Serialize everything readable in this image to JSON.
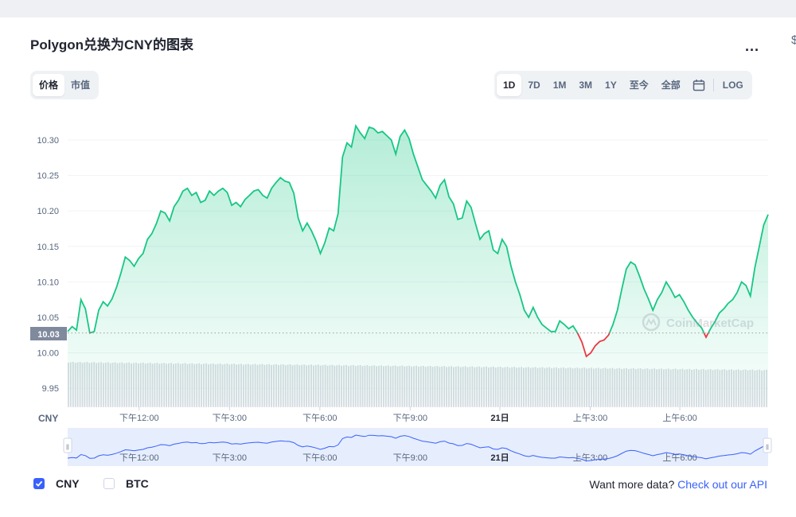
{
  "title": "Polygon兑换为CNY的图表",
  "menu_glyph": "...",
  "edge_glyph": "$",
  "view_tabs": [
    {
      "label": "价格",
      "active": true
    },
    {
      "label": "市值",
      "active": false
    }
  ],
  "range_tabs": [
    {
      "label": "1D",
      "active": true
    },
    {
      "label": "7D",
      "active": false
    },
    {
      "label": "1M",
      "active": false
    },
    {
      "label": "3M",
      "active": false
    },
    {
      "label": "1Y",
      "active": false
    },
    {
      "label": "至今",
      "active": false
    },
    {
      "label": "全部",
      "active": false
    }
  ],
  "calendar_icon": "calendar-icon",
  "log_label": "LOG",
  "chart_data": {
    "type": "line",
    "y_ticks": [
      "10.30",
      "10.25",
      "10.20",
      "10.15",
      "10.10",
      "10.05",
      "10.00",
      "9.95"
    ],
    "ylim": [
      9.925,
      10.335
    ],
    "x_ticks": [
      {
        "label": "下午12:00",
        "t": 0.102
      },
      {
        "label": "下午3:00",
        "t": 0.231
      },
      {
        "label": "下午6:00",
        "t": 0.36
      },
      {
        "label": "下午9:00",
        "t": 0.489
      },
      {
        "label": "21日",
        "t": 0.617,
        "bold": true
      },
      {
        "label": "上午3:00",
        "t": 0.746
      },
      {
        "label": "上午6:00",
        "t": 0.874
      }
    ],
    "currency_label": "CNY",
    "open_price_label": "10.03",
    "open_price": 10.028,
    "series": [
      {
        "values": [
          10.03,
          10.037,
          10.032,
          10.075,
          10.062,
          10.028,
          10.03,
          10.06,
          10.072,
          10.066,
          10.076,
          10.092,
          10.112,
          10.135,
          10.13,
          10.122,
          10.133,
          10.14,
          10.16,
          10.168,
          10.182,
          10.2,
          10.197,
          10.186,
          10.206,
          10.215,
          10.228,
          10.232,
          10.222,
          10.226,
          10.212,
          10.215,
          10.228,
          10.222,
          10.228,
          10.232,
          10.226,
          10.208,
          10.212,
          10.206,
          10.216,
          10.222,
          10.228,
          10.23,
          10.222,
          10.218,
          10.232,
          10.24,
          10.247,
          10.242,
          10.24,
          10.225,
          10.19,
          10.172,
          10.183,
          10.172,
          10.158,
          10.14,
          10.155,
          10.176,
          10.172,
          10.196,
          10.276,
          10.296,
          10.29,
          10.32,
          10.31,
          10.302,
          10.318,
          10.316,
          10.31,
          10.312,
          10.306,
          10.3,
          10.28,
          10.305,
          10.314,
          10.302,
          10.28,
          10.262,
          10.244,
          10.236,
          10.228,
          10.218,
          10.236,
          10.244,
          10.22,
          10.21,
          10.188,
          10.19,
          10.214,
          10.205,
          10.182,
          10.16,
          10.168,
          10.172,
          10.145,
          10.14,
          10.16,
          10.15,
          10.122,
          10.1,
          10.082,
          10.06,
          10.05,
          10.064,
          10.05,
          10.04,
          10.035,
          10.03,
          10.03,
          10.045,
          10.04,
          10.034,
          10.038,
          10.028,
          10.015,
          9.995,
          10.0,
          10.01,
          10.016,
          10.018,
          10.025,
          10.04,
          10.06,
          10.09,
          10.118,
          10.128,
          10.124,
          10.108,
          10.09,
          10.076,
          10.06,
          10.075,
          10.085,
          10.1,
          10.09,
          10.078,
          10.082,
          10.072,
          10.06,
          10.05,
          10.042,
          10.035,
          10.022,
          10.034,
          10.044,
          10.056,
          10.062,
          10.07,
          10.075,
          10.085,
          10.1,
          10.095,
          10.08,
          10.12,
          10.15,
          10.18,
          10.195
        ]
      }
    ],
    "axis_range_pct": [
      3,
      97
    ]
  },
  "navigator_ticks": [
    "下午12:00",
    "下午3:00",
    "下午6:00",
    "下午9:00",
    "21日",
    "上午3:00",
    "上午6:00"
  ],
  "navigator_handle_glyph": "||",
  "watermark": "CoinMarketCap",
  "legend": [
    {
      "label": "CNY",
      "checked": true
    },
    {
      "label": "BTC",
      "checked": false
    }
  ],
  "api_text": "Want more data?",
  "api_link": "Check out our API",
  "colors": {
    "up": "#16c784",
    "down": "#ea3943",
    "accent": "#3861fb",
    "nav_line": "#3861fb"
  }
}
